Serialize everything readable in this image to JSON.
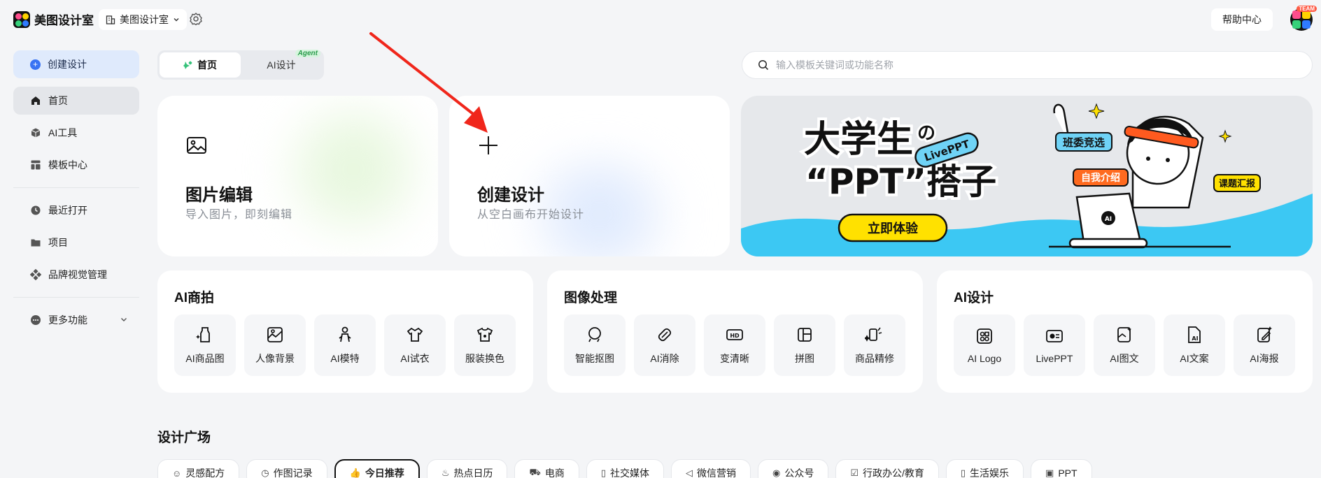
{
  "header": {
    "app_name": "美图设计室",
    "workspace": "美图设计室",
    "help": "帮助中心",
    "team_badge": "TEAM"
  },
  "sidebar": {
    "create": "创建设计",
    "items": [
      {
        "label": "首页",
        "icon": "home-icon"
      },
      {
        "label": "AI工具",
        "icon": "cube-icon"
      },
      {
        "label": "模板中心",
        "icon": "template-icon"
      },
      {
        "label": "最近打开",
        "icon": "clock-icon"
      },
      {
        "label": "项目",
        "icon": "folder-icon"
      },
      {
        "label": "品牌视觉管理",
        "icon": "brand-icon"
      },
      {
        "label": "更多功能",
        "icon": "more-icon"
      }
    ]
  },
  "tabs": [
    {
      "label": "首页"
    },
    {
      "label": "AI设计",
      "badge": "Agent"
    }
  ],
  "search": {
    "placeholder": "输入模板关键词或功能名称"
  },
  "cards": {
    "edit": {
      "title": "图片编辑",
      "subtitle": "导入图片，即刻编辑"
    },
    "create": {
      "title": "创建设计",
      "subtitle": "从空白画布开始设计"
    }
  },
  "banner": {
    "line1": "大学生",
    "no": "の",
    "line2": "“PPT”搭子",
    "tag_livePPT": "LivePPT",
    "cta": "立即体验",
    "bubble1": "班委竞选",
    "bubble2": "自我介绍",
    "bubble3": "课题汇报",
    "laptop_label": "AI"
  },
  "sections": {
    "ai_shoot": {
      "title": "AI商拍",
      "tools": [
        "AI商品图",
        "人像背景",
        "AI模特",
        "AI试衣",
        "服装换色"
      ]
    },
    "image": {
      "title": "图像处理",
      "tools": [
        "智能抠图",
        "AI消除",
        "变清晰",
        "拼图",
        "商品精修"
      ]
    },
    "ai_design": {
      "title": "AI设计",
      "tools": [
        "AI Logo",
        "LivePPT",
        "AI图文",
        "AI文案",
        "AI海报"
      ]
    }
  },
  "plaza": {
    "title": "设计广场",
    "chips": [
      "灵感配方",
      "作图记录",
      "今日推荐",
      "热点日历",
      "电商",
      "社交媒体",
      "微信营销",
      "公众号",
      "行政办公/教育",
      "生活娱乐",
      "PPT"
    ]
  },
  "colors": {
    "accent": "#3a74f3",
    "banner_bg": "#e6e8eb",
    "banner_wave": "#3cc8f3",
    "banner_cta": "#ffe100"
  }
}
